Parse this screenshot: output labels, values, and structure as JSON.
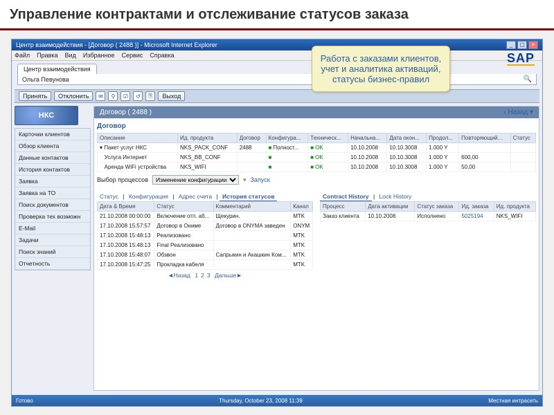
{
  "slide_title": "Управление контрактами и отслеживание статусов заказа",
  "callout": "Работа с заказами клиентов, учет и аналитика активаций, статусы бизнес-правил",
  "sap_logo": "SAP",
  "window": {
    "title": "Центр взаимодействия - [Договор ( 2488 )] - Microsoft Internet Explorer",
    "menu": [
      "Файл",
      "Правка",
      "Вид",
      "Избранное",
      "Сервис",
      "Справка"
    ],
    "tab": "Центр взаимодействия",
    "user": "Ольга Певунова",
    "toolbar": {
      "accept": "Принять",
      "decline": "Отклонить",
      "exit": "Выход"
    },
    "crumb_title": "Договор ( 2488 )",
    "crumb_back": "‹ Назад ▾"
  },
  "nav": [
    "Карточки клиентов",
    "Обзор клиента",
    "Данные контактов",
    "История контактов",
    "Заявка",
    "Заявка на ТО",
    "Поиск документов",
    "Проверка тех возможн",
    "E-Mail",
    "Задачи",
    "Поиск знаний",
    "Отчетность"
  ],
  "logo_text": "НКС",
  "contract": {
    "heading": "Договор",
    "columns": [
      "Описание",
      "Ид. продукта",
      "Договор",
      "Конфигура...",
      "Техническ...",
      "Начальна...",
      "Дата окон...",
      "Продол...",
      "Повторяющий...",
      "Статус"
    ],
    "rows": [
      {
        "desc": "Пакет услуг НКС",
        "pid": "NKS_PACK_CONF",
        "dog": "2488",
        "cfg": "Полност...",
        "tech": "OK",
        "start": "10.10.2008",
        "end": "10.10.3008",
        "dur": "1.000 Y",
        "rep": "",
        "status": ""
      },
      {
        "desc": "Услуга Интернет",
        "pid": "NKS_BB_CONF",
        "dog": "",
        "cfg": "",
        "tech": "OK",
        "start": "10.10.2008",
        "end": "10.10.3008",
        "dur": "1.000 Y",
        "rep": "600,00",
        "status": ""
      },
      {
        "desc": "Аренда WiFi устройства",
        "pid": "NKS_WIFI",
        "dog": "",
        "cfg": "",
        "tech": "OK",
        "start": "10.10.2008",
        "end": "10.10.3008",
        "dur": "1.000 Y",
        "rep": "50,00",
        "status": ""
      }
    ]
  },
  "processes": {
    "label": "Выбор процессов",
    "value": "Изменение конфигурации",
    "launch": "Запуск"
  },
  "history": {
    "tabs": [
      "Статус",
      "Конфигурация",
      "Адрес счета",
      "История статусов"
    ],
    "active": 3,
    "columns": [
      "Дата & Время",
      "Статус",
      "Комментарий",
      "Канал"
    ],
    "rows": [
      {
        "dt": "21.10.2008 00:00:00",
        "st": "Включение отп. аб...",
        "cm": "Щекурин.",
        "ch": "MTK"
      },
      {
        "dt": "17.10.2008 15:57:57",
        "st": "Договор в Ониме",
        "cm": "Договор в ONYMA заведен",
        "ch": "ONYM"
      },
      {
        "dt": "17.10.2008 15:48:13",
        "st": "Реализовано",
        "cm": "",
        "ch": "MTK"
      },
      {
        "dt": "17.10.2008 15:48:13",
        "st": "Final Реализовано",
        "cm": "",
        "ch": "MTK"
      },
      {
        "dt": "17.10.2008 15:48:07",
        "st": "Обзвон",
        "cm": "Сапрыкин и Акашкин Ком...",
        "ch": "MTK"
      },
      {
        "dt": "17.10.2008 15:47:25",
        "st": "Прокладка кабеля",
        "cm": "",
        "ch": "MTK"
      }
    ],
    "pager": {
      "back": "◄Назад",
      "pages": [
        "1",
        "2",
        "3"
      ],
      "next": "Дальше►"
    }
  },
  "right": {
    "tabs": [
      "Contract History",
      "Lock History"
    ],
    "columns": [
      "Процесс",
      "Дата активации",
      "Статус заказа",
      "Ид. заказа",
      "Ид. продукта"
    ],
    "rows": [
      {
        "proc": "Заказ клиента",
        "date": "10.10.2008",
        "status": "Исполнено",
        "oid": "5025194",
        "pid": "NKS_WIFI"
      }
    ]
  },
  "statusbar": {
    "ready": "Готово",
    "date": "Thursday, October 23, 2008 11:39",
    "intranet": "Местная интрасеть"
  }
}
